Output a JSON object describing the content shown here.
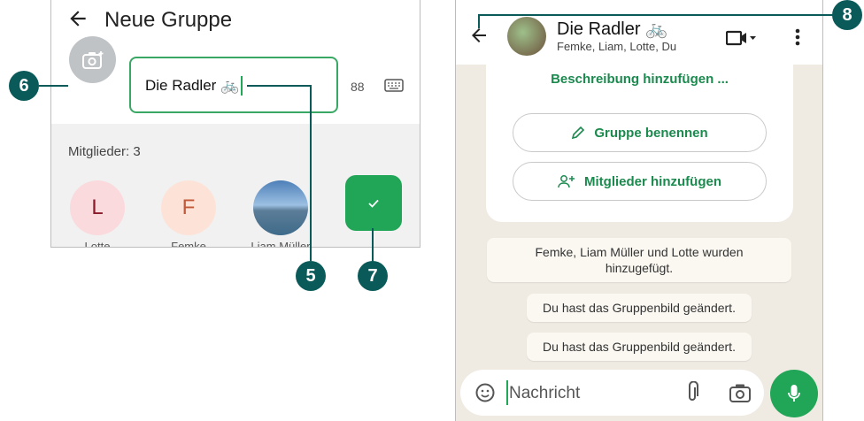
{
  "left": {
    "title": "Neue Gruppe",
    "group_name": "Die Radler 🚲",
    "char_count": "88",
    "members_label": "Mitglieder: 3",
    "members": [
      {
        "initial": "L",
        "name": "Lotte",
        "bg": "#fadadd",
        "fg": "#8b1a2b"
      },
      {
        "initial": "F",
        "name": "Femke",
        "bg": "#fde3d7",
        "fg": "#c0593a"
      },
      {
        "initial": "",
        "name": "Liam Müller",
        "bg": "#6d98c4",
        "fg": "#ffffff"
      }
    ],
    "confirm_icon": "check-icon"
  },
  "callouts": {
    "c5": "5",
    "c6": "6",
    "c7": "7",
    "c8": "8"
  },
  "right": {
    "chat_title": "Die Radler 🚲",
    "chat_subtitle": "Femke, Liam, Lotte, Du",
    "add_description": "Beschreibung hinzufügen ...",
    "rename_group": "Gruppe benennen",
    "add_members": "Mitglieder hinzufügen",
    "msg_added": "Femke, Liam Müller und Lotte wurden hinzugefügt.",
    "msg_picture_1": "Du hast das Gruppenbild geändert.",
    "msg_picture_2": "Du hast das Gruppenbild geändert.",
    "input_placeholder": "Nachricht"
  },
  "colors": {
    "accent_green": "#21a557",
    "callout": "#0a5a5a",
    "chat_bg": "#efeae2"
  }
}
